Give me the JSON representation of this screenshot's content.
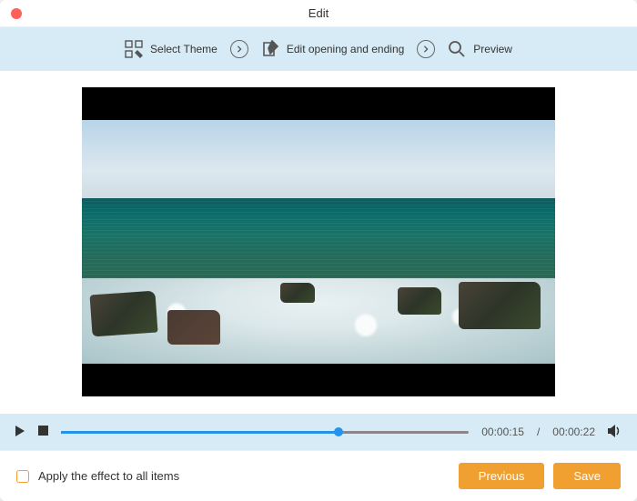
{
  "window": {
    "title": "Edit"
  },
  "toolbar": {
    "select_theme": "Select Theme",
    "edit_opening": "Edit opening and ending",
    "preview": "Preview"
  },
  "playback": {
    "current_time": "00:00:15",
    "total_time": "00:00:22",
    "progress_percent": 68
  },
  "footer": {
    "apply_all_label": "Apply the effect to all items",
    "apply_all_checked": false,
    "previous_label": "Previous",
    "save_label": "Save"
  },
  "colors": {
    "accent": "#f0a030",
    "panel": "#d6ebf5",
    "progress": "#2592ec"
  }
}
